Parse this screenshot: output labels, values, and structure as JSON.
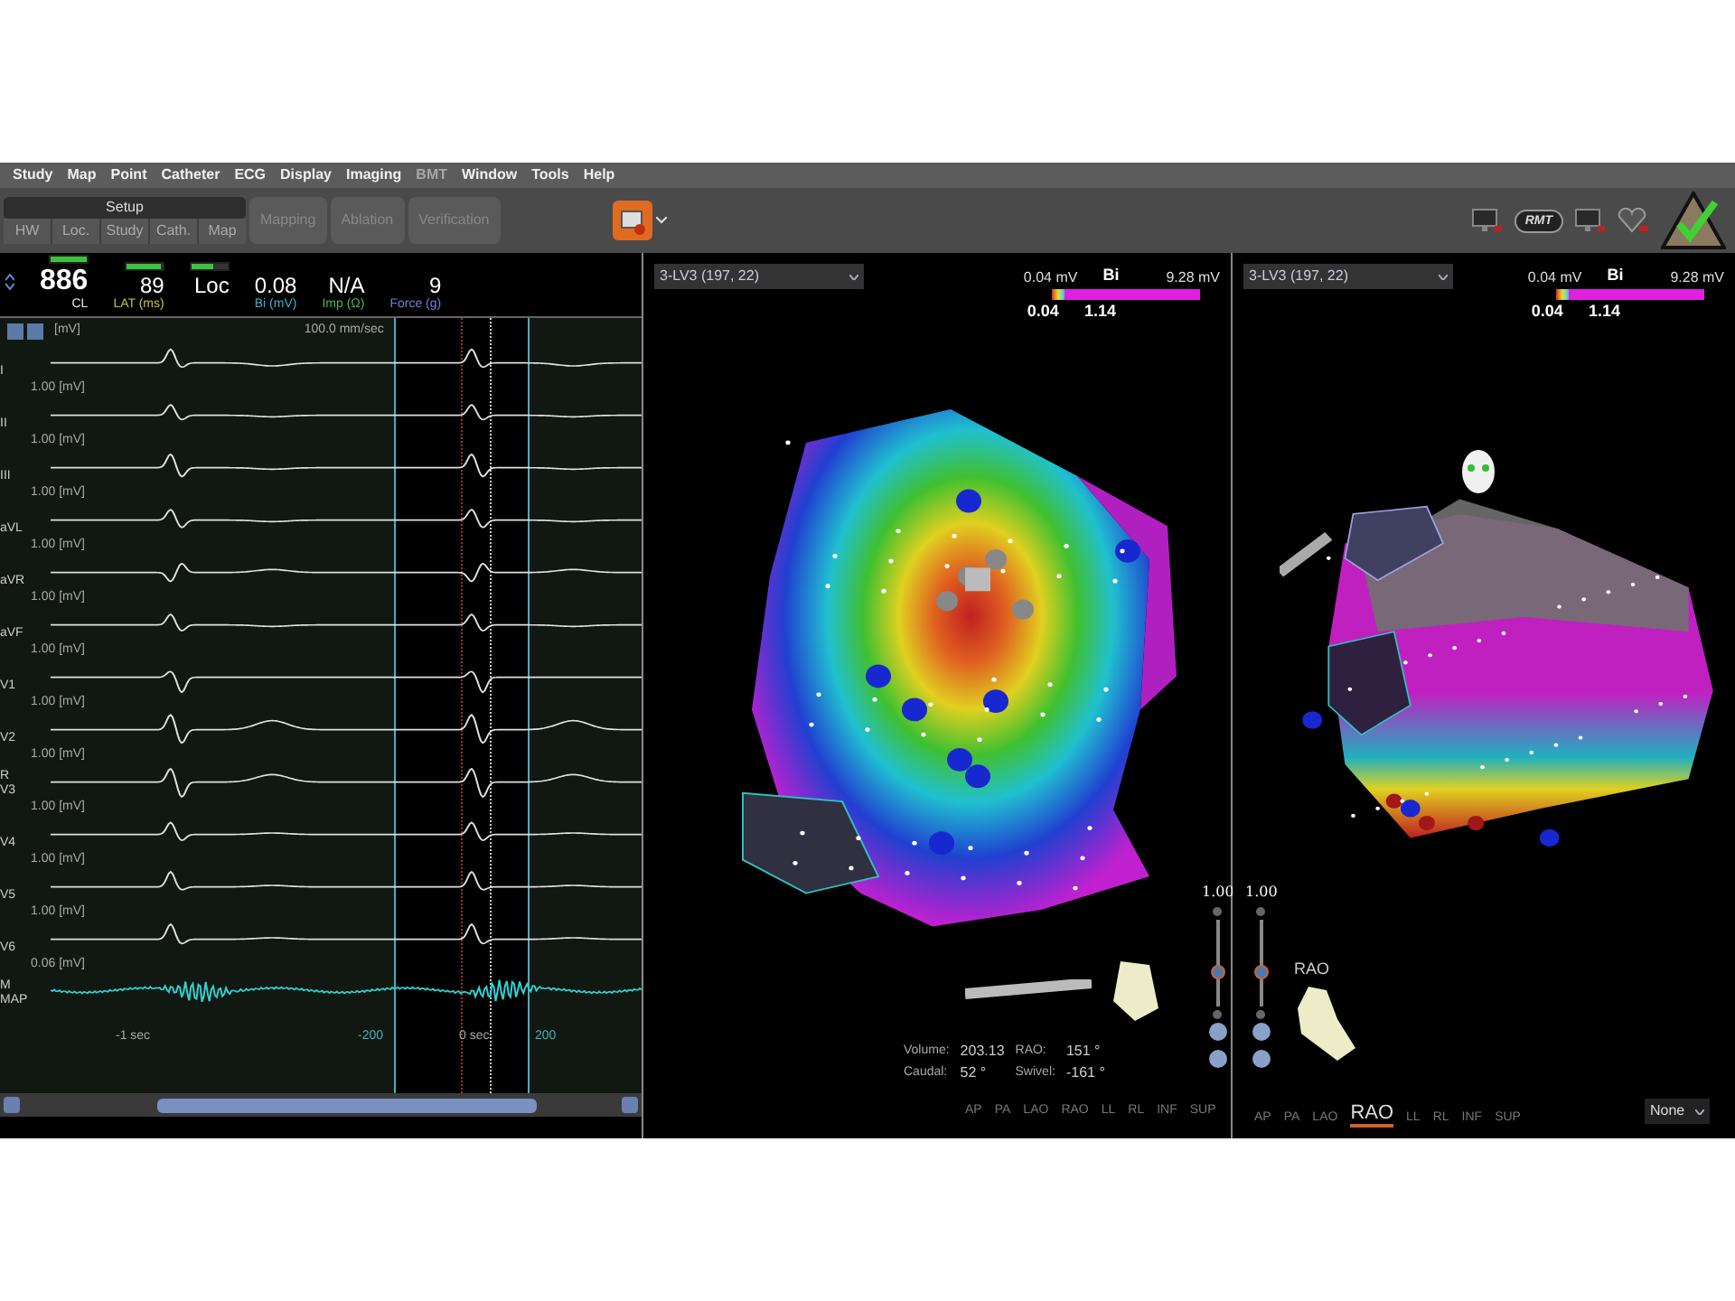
{
  "menu": [
    {
      "label": "Study",
      "disabled": false
    },
    {
      "label": "Map",
      "disabled": false
    },
    {
      "label": "Point",
      "disabled": false
    },
    {
      "label": "Catheter",
      "disabled": false
    },
    {
      "label": "ECG",
      "disabled": false
    },
    {
      "label": "Display",
      "disabled": false
    },
    {
      "label": "Imaging",
      "disabled": false
    },
    {
      "label": "BMT",
      "disabled": true
    },
    {
      "label": "Window",
      "disabled": false
    },
    {
      "label": "Tools",
      "disabled": false
    },
    {
      "label": "Help",
      "disabled": false
    }
  ],
  "toolbar": {
    "setup": {
      "title": "Setup",
      "tabs": [
        "HW",
        "Loc.",
        "Study",
        "Cath.",
        "Map"
      ]
    },
    "workflow": [
      {
        "label": "Mapping",
        "disabled": true
      },
      {
        "label": "Ablation",
        "disabled": true
      },
      {
        "label": "Verification",
        "disabled": true
      }
    ],
    "status_icons": [
      {
        "kind": "monitor"
      },
      {
        "kind": "pill",
        "label": "RMT"
      },
      {
        "kind": "monitor"
      },
      {
        "kind": "heart"
      },
      {
        "kind": "check"
      }
    ]
  },
  "ecg": {
    "readouts": [
      {
        "value": "886",
        "label": "CL",
        "color": "#e8e8e8",
        "level": 1
      },
      {
        "value": "89",
        "label": "LAT (ms)",
        "color": "#c8c040",
        "level": 0.95
      },
      {
        "value": "Loc",
        "level": 0.6
      },
      {
        "value": "0.08",
        "label": "Bi (mV)",
        "color": "#40b0c8"
      },
      {
        "value": "N/A",
        "label": "Imp (Ω)",
        "color": "#40b850"
      },
      {
        "value": "9",
        "label": "Force (g)",
        "color": "#7080d8"
      }
    ],
    "unit": "[mV]",
    "speed": "100.0 mm/sec",
    "leads": [
      {
        "name": "I",
        "scale": "1.00 [mV]"
      },
      {
        "name": "II",
        "scale": "1.00 [mV]"
      },
      {
        "name": "III",
        "scale": "1.00 [mV]"
      },
      {
        "name": "aVL",
        "scale": "1.00 [mV]"
      },
      {
        "name": "aVR",
        "scale": "1.00 [mV]"
      },
      {
        "name": "aVF",
        "scale": "1.00 [mV]"
      },
      {
        "name": "V1",
        "scale": "1.00 [mV]"
      },
      {
        "name": "V2",
        "scale": "1.00 [mV]"
      },
      {
        "name": "V3",
        "marker": "R",
        "scale": "1.00 [mV]"
      },
      {
        "name": "V4",
        "scale": "1.00 [mV]"
      },
      {
        "name": "V5",
        "scale": "1.00 [mV]"
      },
      {
        "name": "V6",
        "scale": "0.06 [mV]"
      },
      {
        "name": "MAP",
        "marker": "M",
        "kind": "map"
      }
    ],
    "time_labels": [
      "-1 sec",
      "-200",
      "0 sec",
      "200"
    ]
  },
  "maps": [
    {
      "catheter": "3-LV3 (197, 22)",
      "scale": {
        "min": "0.04 mV",
        "mode": "Bi",
        "max": "9.28 mV",
        "low": "0.04",
        "high": "1.14",
        "level": 0.08
      },
      "zoom": {
        "value": "1.00",
        "level": 0.4
      },
      "stats": [
        {
          "label": "Volume:",
          "value": "203.13"
        },
        {
          "label": "RAO:",
          "value": "151 °"
        },
        {
          "label": "Caudal:",
          "value": "52 °"
        },
        {
          "label": "Swivel:",
          "value": "-161 °"
        }
      ],
      "views": [
        {
          "label": "AP",
          "selected": false
        },
        {
          "label": "PA",
          "selected": false
        },
        {
          "label": "LAO",
          "selected": false
        },
        {
          "label": "RAO",
          "selected": false
        },
        {
          "label": "LL",
          "selected": false
        },
        {
          "label": "RL",
          "selected": false
        },
        {
          "label": "INF",
          "selected": false
        },
        {
          "label": "SUP",
          "selected": false
        }
      ]
    },
    {
      "catheter": "3-LV3 (197, 22)",
      "scale": {
        "min": "0.04 mV",
        "mode": "Bi",
        "max": "9.28 mV",
        "low": "0.04",
        "high": "1.14",
        "level": 0.08
      },
      "zoom": {
        "value": "1.00",
        "level": 0.4
      },
      "orientation": "RAO",
      "display": "None",
      "views": [
        {
          "label": "AP",
          "selected": false
        },
        {
          "label": "PA",
          "selected": false
        },
        {
          "label": "LAO",
          "selected": false
        },
        {
          "label": "RAO",
          "selected": true
        },
        {
          "label": "LL",
          "selected": false
        },
        {
          "label": "RL",
          "selected": false
        },
        {
          "label": "INF",
          "selected": false
        },
        {
          "label": "SUP",
          "selected": false
        }
      ]
    }
  ]
}
